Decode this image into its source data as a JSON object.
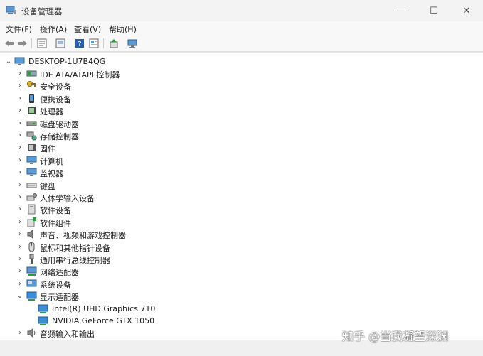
{
  "window": {
    "title": "设备管理器",
    "app_icon": "device-manager-icon",
    "controls": [
      "minimize-icon",
      "maximize-icon",
      "close-icon"
    ]
  },
  "menu": [
    "文件(F)",
    "操作(A)",
    "查看(V)",
    "帮助(H)"
  ],
  "toolbar": [
    "back-arrow-icon",
    "forward-arrow-icon",
    "properties-icon",
    "show-hidden-icon",
    "help-icon",
    "details-icon",
    "update-driver-icon",
    "scan-hardware-icon"
  ],
  "tree": {
    "root": {
      "label": "DESKTOP-1U7B4QG",
      "icon": "computer-icon",
      "expanded": true
    },
    "categories": [
      {
        "label": "IDE ATA/ATAPI 控制器",
        "icon": "ide-controller-icon",
        "expanded": false
      },
      {
        "label": "安全设备",
        "icon": "security-key-icon",
        "expanded": false
      },
      {
        "label": "便携设备",
        "icon": "portable-device-icon",
        "expanded": false
      },
      {
        "label": "处理器",
        "icon": "processor-icon",
        "expanded": false
      },
      {
        "label": "磁盘驱动器",
        "icon": "disk-drive-icon",
        "expanded": false
      },
      {
        "label": "存储控制器",
        "icon": "storage-controller-icon",
        "expanded": false
      },
      {
        "label": "固件",
        "icon": "firmware-icon",
        "expanded": false
      },
      {
        "label": "计算机",
        "icon": "monitor-icon",
        "expanded": false
      },
      {
        "label": "监视器",
        "icon": "monitor-icon",
        "expanded": false
      },
      {
        "label": "键盘",
        "icon": "keyboard-icon",
        "expanded": false
      },
      {
        "label": "人体学输入设备",
        "icon": "hid-icon",
        "expanded": false
      },
      {
        "label": "软件设备",
        "icon": "software-device-icon",
        "expanded": false
      },
      {
        "label": "软件组件",
        "icon": "software-component-icon",
        "expanded": false
      },
      {
        "label": "声音、视频和游戏控制器",
        "icon": "speaker-icon",
        "expanded": false
      },
      {
        "label": "鼠标和其他指针设备",
        "icon": "mouse-icon",
        "expanded": false
      },
      {
        "label": "通用串行总线控制器",
        "icon": "usb-icon",
        "expanded": false
      },
      {
        "label": "网络适配器",
        "icon": "network-adapter-icon",
        "expanded": false
      },
      {
        "label": "系统设备",
        "icon": "system-device-icon",
        "expanded": false
      },
      {
        "label": "显示适配器",
        "icon": "display-adapter-icon",
        "expanded": true,
        "children": [
          {
            "label": "Intel(R) UHD Graphics 710",
            "icon": "display-adapter-icon"
          },
          {
            "label": "NVIDIA GeForce GTX 1050",
            "icon": "display-adapter-icon"
          }
        ]
      },
      {
        "label": "音频输入和输出",
        "icon": "audio-io-icon",
        "expanded": false
      }
    ]
  },
  "watermark": "知乎 @当我凝望深渊",
  "colors": {
    "titlebar": "#f3f3f3",
    "menubar": "#f8f8f8",
    "tree_bg": "#ffffff",
    "accent_blue": "#2a7bd4"
  }
}
